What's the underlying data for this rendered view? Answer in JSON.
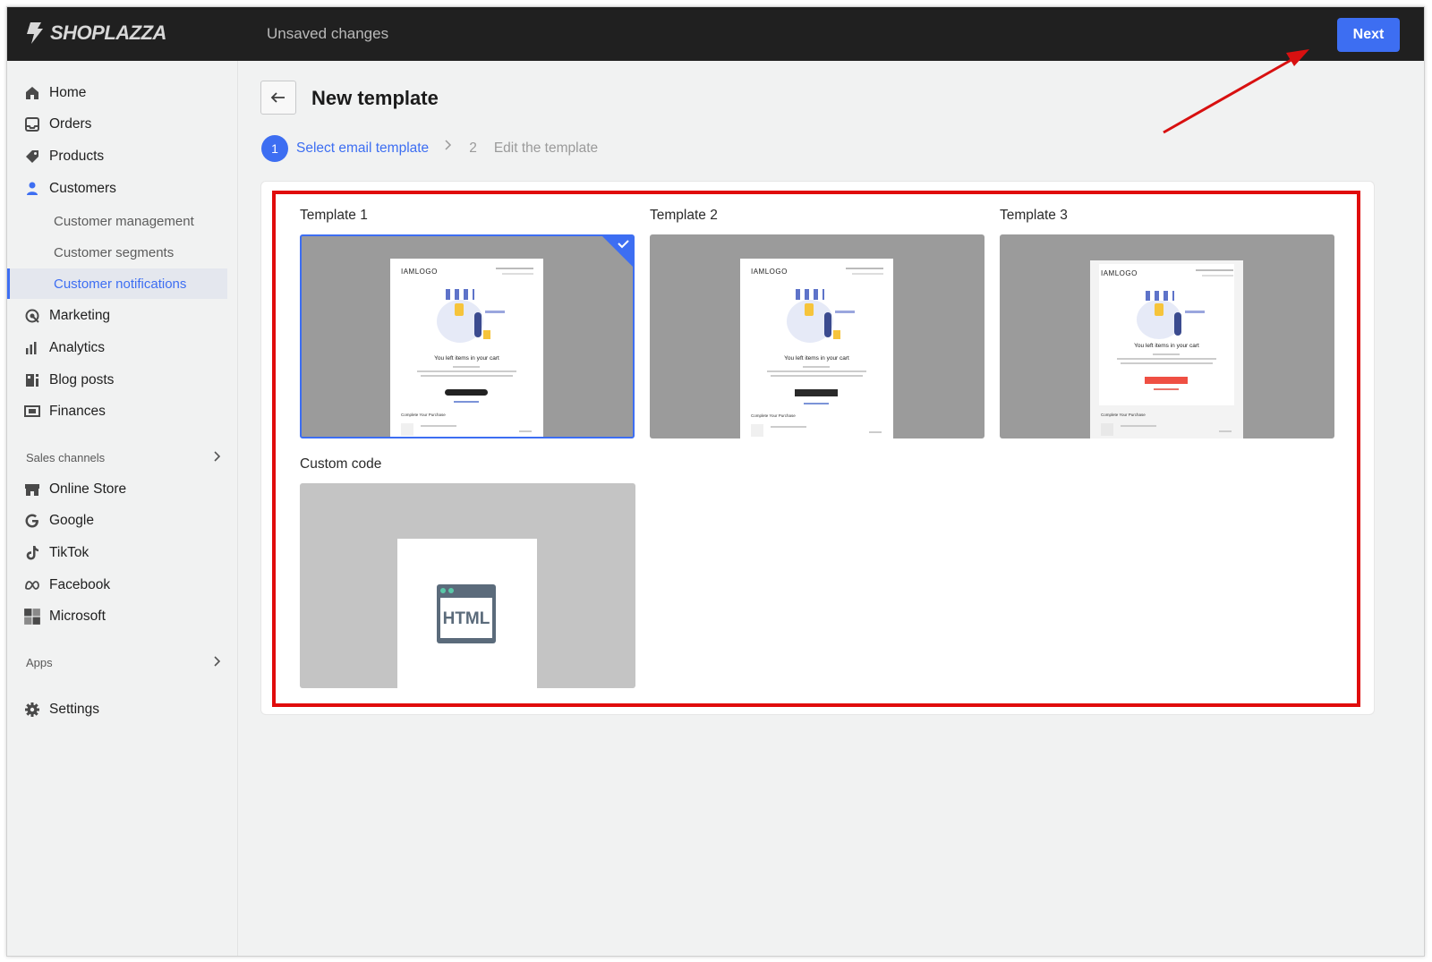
{
  "topbar": {
    "brand": "SHOPLAZZA",
    "status": "Unsaved changes",
    "next_label": "Next"
  },
  "sidebar": {
    "items": [
      {
        "label": "Home",
        "icon": "home-icon"
      },
      {
        "label": "Orders",
        "icon": "inbox-icon"
      },
      {
        "label": "Products",
        "icon": "tag-icon"
      },
      {
        "label": "Customers",
        "icon": "person-icon"
      }
    ],
    "customer_sub": [
      {
        "label": "Customer management"
      },
      {
        "label": "Customer segments"
      },
      {
        "label": "Customer notifications",
        "active": true
      }
    ],
    "items2": [
      {
        "label": "Marketing",
        "icon": "target-icon"
      },
      {
        "label": "Analytics",
        "icon": "bar-chart-icon"
      },
      {
        "label": "Blog posts",
        "icon": "blog-icon"
      },
      {
        "label": "Finances",
        "icon": "finance-icon"
      }
    ],
    "sales_channels_label": "Sales channels",
    "channels": [
      {
        "label": "Online Store",
        "icon": "store-icon"
      },
      {
        "label": "Google",
        "icon": "google-icon"
      },
      {
        "label": "TikTok",
        "icon": "tiktok-icon"
      },
      {
        "label": "Facebook",
        "icon": "meta-icon"
      },
      {
        "label": "Microsoft",
        "icon": "microsoft-icon"
      }
    ],
    "apps_label": "Apps",
    "settings_label": "Settings"
  },
  "main": {
    "title": "New template",
    "steps": [
      {
        "num": "1",
        "label": "Select email template",
        "active": true
      },
      {
        "num": "2",
        "label": "Edit the template",
        "active": false
      }
    ],
    "templates": [
      {
        "label": "Template 1",
        "selected": true
      },
      {
        "label": "Template 2",
        "selected": false
      },
      {
        "label": "Template 3",
        "selected": false
      }
    ],
    "custom_label": "Custom code",
    "custom_icon_text": "HTML",
    "email_preview": {
      "logo": "IAMLOGO",
      "headline": "You left items in your cart",
      "section": "Complete Your Purchase"
    }
  },
  "colors": {
    "accent": "#3d6ef2",
    "topbar": "#202020",
    "highlight": "#e00c0c"
  }
}
